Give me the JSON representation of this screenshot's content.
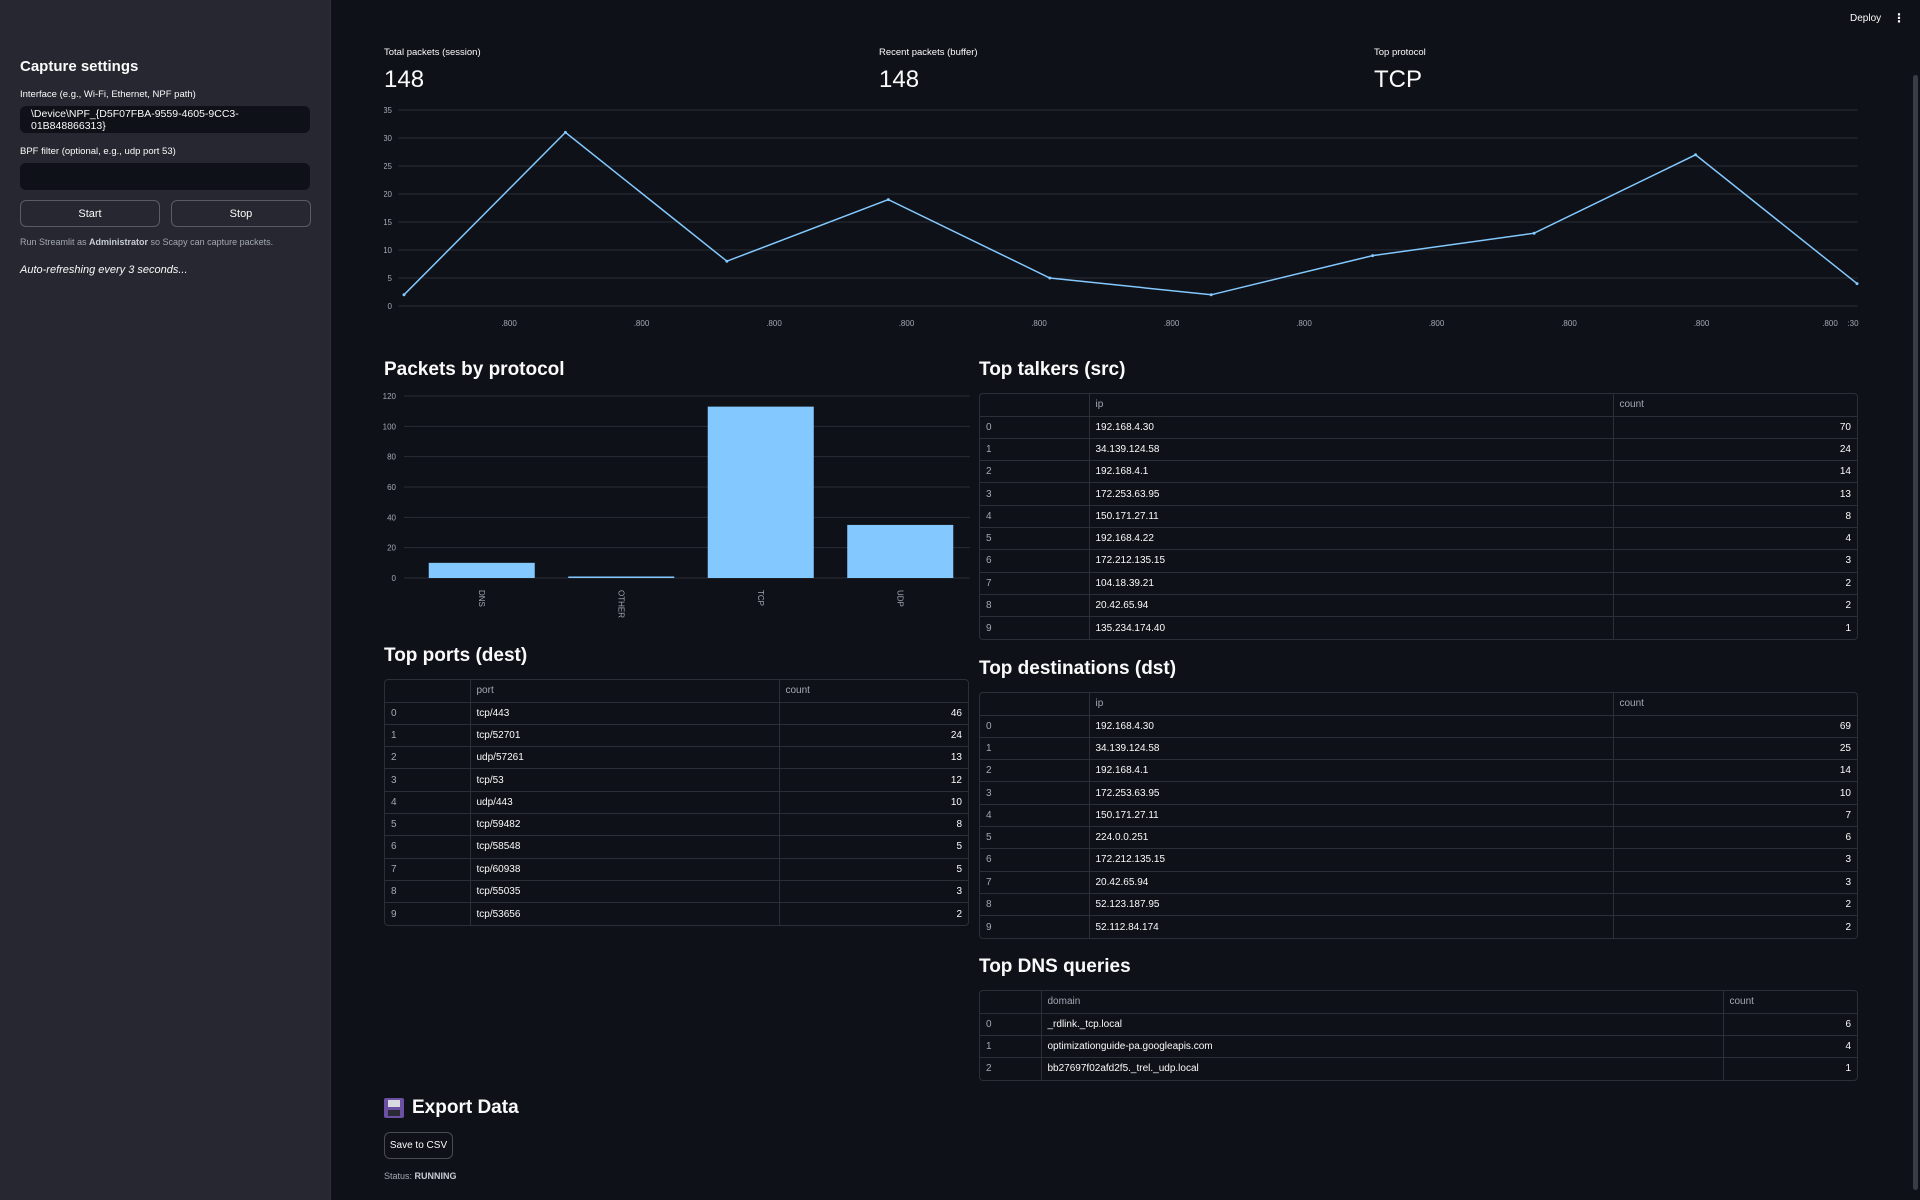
{
  "sidebar": {
    "heading": "Capture settings",
    "interface_label": "Interface (e.g., Wi-Fi, Ethernet, NPF path)",
    "interface_value": "\\Device\\NPF_{D5F07FBA-9559-4605-9CC3-01B848866313}",
    "bpf_label": "BPF filter (optional, e.g., udp port 53)",
    "bpf_value": "",
    "start_label": "Start",
    "stop_label": "Stop",
    "note_prefix": "Run Streamlit as ",
    "note_bold": "Administrator",
    "note_suffix": " so Scapy can capture packets.",
    "auto_refresh": "Auto-refreshing every 3 seconds..."
  },
  "topbar": {
    "deploy_label": "Deploy",
    "menu_icon": "vertical-dots-icon"
  },
  "metrics": [
    {
      "label": "Total packets (session)",
      "value": "148"
    },
    {
      "label": "Recent packets (buffer)",
      "value": "148"
    },
    {
      "label": "Top protocol",
      "value": "TCP"
    }
  ],
  "chart_data": [
    {
      "type": "line",
      "y": [
        2,
        31,
        8,
        19,
        5,
        2,
        9,
        13,
        27,
        4
      ],
      "x_points": 10,
      "ylim": [
        0,
        35
      ],
      "yticks": [
        0,
        5,
        10,
        15,
        20,
        25,
        30,
        35
      ],
      "xtick_labels": [
        ".800",
        ".800",
        ".800",
        ".800",
        ".800",
        ".800",
        ".800",
        ".800",
        ".800",
        ".800",
        ".800",
        ":30"
      ],
      "color": "#83c9ff",
      "grid": true
    },
    {
      "type": "bar",
      "title": "Packets by protocol",
      "categories": [
        "DNS",
        "OTHER",
        "TCP",
        "UDP"
      ],
      "values": [
        10,
        1,
        113,
        35
      ],
      "ylim": [
        0,
        120
      ],
      "yticks": [
        0,
        20,
        40,
        60,
        80,
        100,
        120
      ],
      "color": "#83c9ff",
      "grid": true
    }
  ],
  "sections": {
    "protocol_title": "Packets by protocol",
    "talkers_title": "Top talkers (src)",
    "ports_title": "Top ports (dest)",
    "destinations_title": "Top destinations (dst)",
    "dns_title": "Top DNS queries",
    "export_title": "Export Data"
  },
  "talkers": {
    "columns": [
      "",
      "ip",
      "count"
    ],
    "rows": [
      [
        "0",
        "192.168.4.30",
        "70"
      ],
      [
        "1",
        "34.139.124.58",
        "24"
      ],
      [
        "2",
        "192.168.4.1",
        "14"
      ],
      [
        "3",
        "172.253.63.95",
        "13"
      ],
      [
        "4",
        "150.171.27.11",
        "8"
      ],
      [
        "5",
        "192.168.4.22",
        "4"
      ],
      [
        "6",
        "172.212.135.15",
        "3"
      ],
      [
        "7",
        "104.18.39.21",
        "2"
      ],
      [
        "8",
        "20.42.65.94",
        "2"
      ],
      [
        "9",
        "135.234.174.40",
        "1"
      ]
    ]
  },
  "ports": {
    "columns": [
      "",
      "port",
      "count"
    ],
    "rows": [
      [
        "0",
        "tcp/443",
        "46"
      ],
      [
        "1",
        "tcp/52701",
        "24"
      ],
      [
        "2",
        "udp/57261",
        "13"
      ],
      [
        "3",
        "tcp/53",
        "12"
      ],
      [
        "4",
        "udp/443",
        "10"
      ],
      [
        "5",
        "tcp/59482",
        "8"
      ],
      [
        "6",
        "tcp/58548",
        "5"
      ],
      [
        "7",
        "tcp/60938",
        "5"
      ],
      [
        "8",
        "tcp/55035",
        "3"
      ],
      [
        "9",
        "tcp/53656",
        "2"
      ]
    ]
  },
  "destinations": {
    "columns": [
      "",
      "ip",
      "count"
    ],
    "rows": [
      [
        "0",
        "192.168.4.30",
        "69"
      ],
      [
        "1",
        "34.139.124.58",
        "25"
      ],
      [
        "2",
        "192.168.4.1",
        "14"
      ],
      [
        "3",
        "172.253.63.95",
        "10"
      ],
      [
        "4",
        "150.171.27.11",
        "7"
      ],
      [
        "5",
        "224.0.0.251",
        "6"
      ],
      [
        "6",
        "172.212.135.15",
        "3"
      ],
      [
        "7",
        "20.42.65.94",
        "3"
      ],
      [
        "8",
        "52.123.187.95",
        "2"
      ],
      [
        "9",
        "52.112.84.174",
        "2"
      ]
    ]
  },
  "dns": {
    "columns": [
      "",
      "domain",
      "count"
    ],
    "rows": [
      [
        "0",
        "_rdlink._tcp.local",
        "6"
      ],
      [
        "1",
        "optimizationguide-pa.googleapis.com",
        "4"
      ],
      [
        "2",
        "bb27697f02afd2f5._trel._udp.local",
        "1"
      ]
    ]
  },
  "export": {
    "icon": "floppy-disk-icon",
    "save_label": "Save to CSV",
    "status_prefix": "Status: ",
    "status_value": "RUNNING"
  }
}
